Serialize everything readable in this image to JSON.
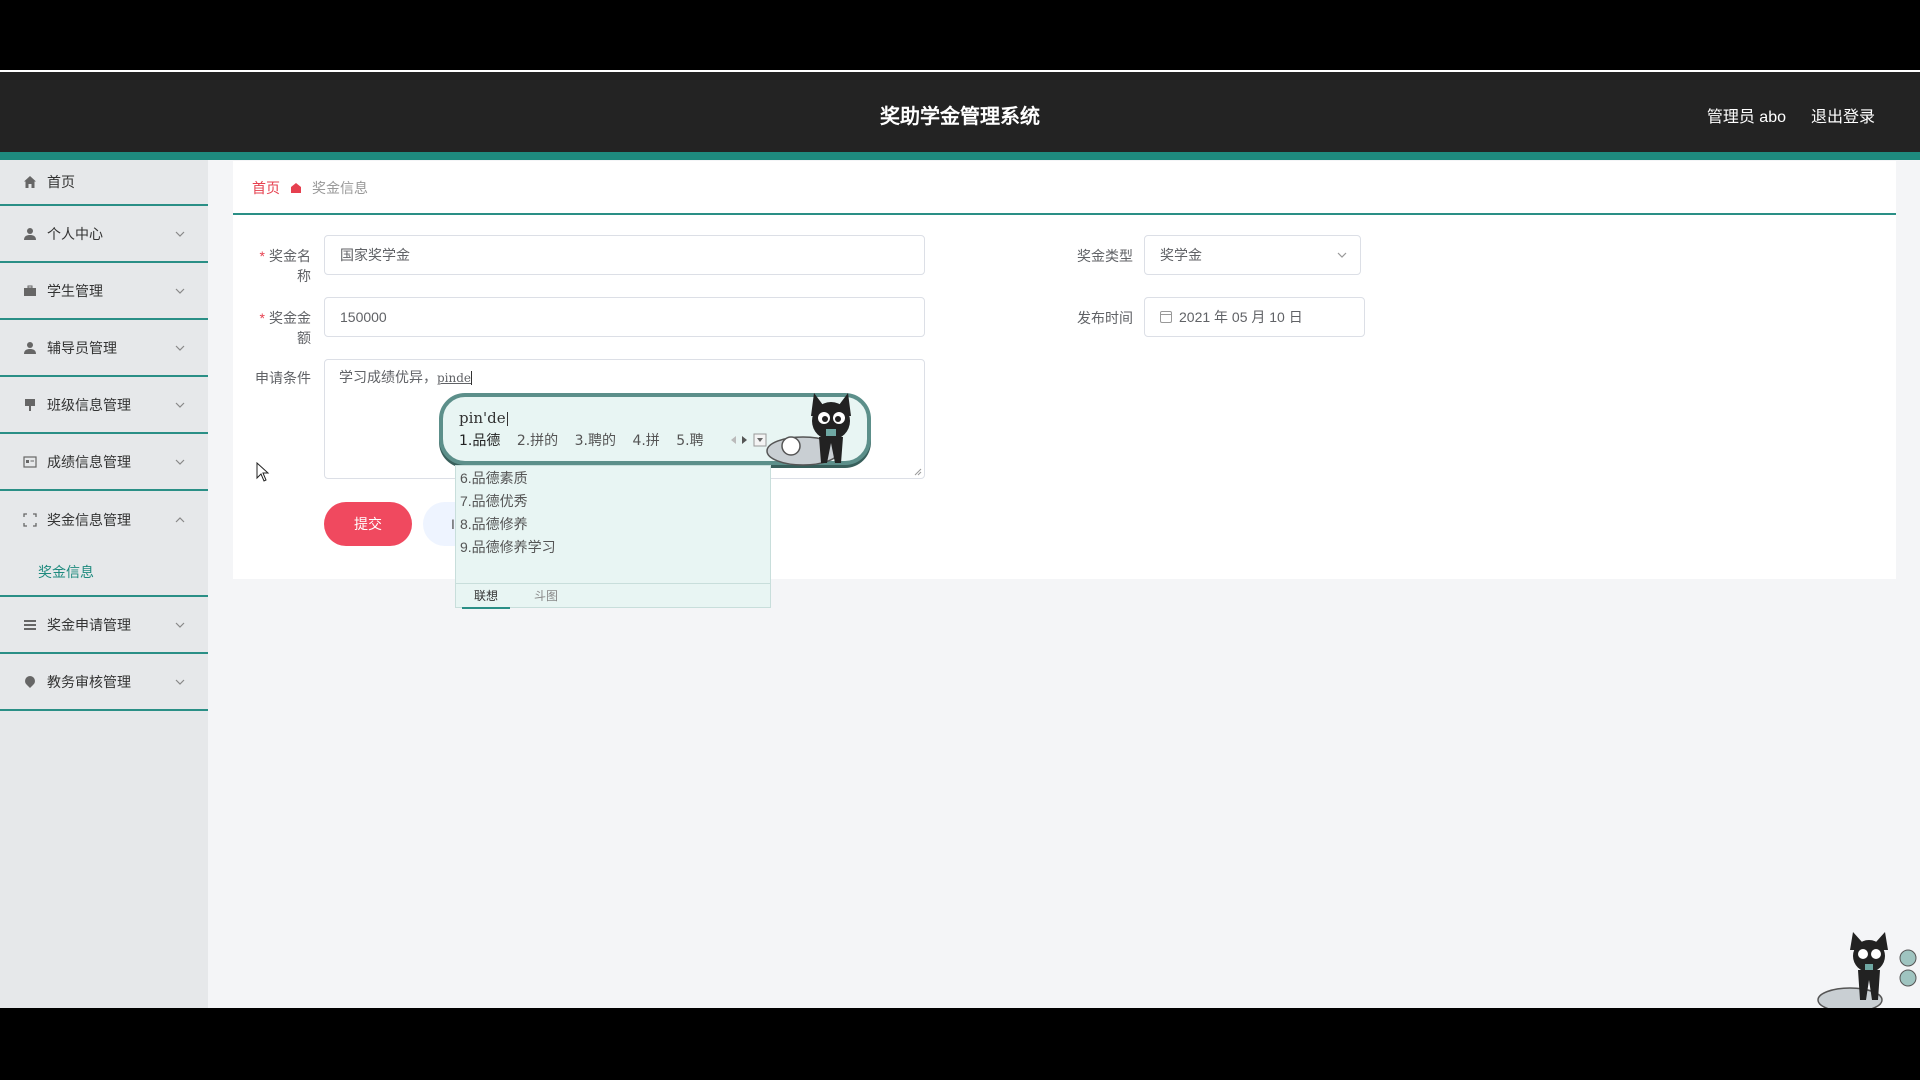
{
  "header": {
    "title": "奖助学金管理系统",
    "user": "管理员 abo",
    "logout": "退出登录"
  },
  "sidebar": {
    "items": [
      {
        "label": "首页",
        "icon": "home-icon"
      },
      {
        "label": "个人中心",
        "icon": "user-icon"
      },
      {
        "label": "学生管理",
        "icon": "briefcase-icon"
      },
      {
        "label": "辅导员管理",
        "icon": "user-icon"
      },
      {
        "label": "班级信息管理",
        "icon": "flag-icon"
      },
      {
        "label": "成绩信息管理",
        "icon": "card-icon"
      },
      {
        "label": "奖金信息管理",
        "icon": "expand-icon"
      },
      {
        "label": "奖金申请管理",
        "icon": "list-icon"
      },
      {
        "label": "教务审核管理",
        "icon": "pin-icon"
      }
    ],
    "open_sub": "奖金信息"
  },
  "breadcrumb": {
    "home": "首页",
    "current": "奖金信息"
  },
  "form": {
    "name_label": "奖金名称",
    "name_value": "国家奖学金",
    "amount_label": "奖金金额",
    "amount_value": "150000",
    "condition_label": "申请条件",
    "condition_value": "学习成绩优异，",
    "condition_typing": "pinde",
    "type_label": "奖金类型",
    "type_value": "奖学金",
    "date_label": "发布时间",
    "date_value": "2021 年 05 月 10 日",
    "submit": "提交",
    "reset_initial": "I"
  },
  "ime": {
    "pinyin": "pin'de",
    "candidates": [
      "1.品德",
      "2.拼的",
      "3.聘的",
      "4.拼",
      "5.聘"
    ],
    "more": [
      "6.品德素质",
      "7.品德优秀",
      "8.品德修养",
      "9.品德修养学习"
    ],
    "tab_assoc": "联想",
    "tab_sticker": "斗图"
  },
  "colors": {
    "accent": "#1e8a7e",
    "danger": "#f0495f",
    "header": "#232323"
  }
}
